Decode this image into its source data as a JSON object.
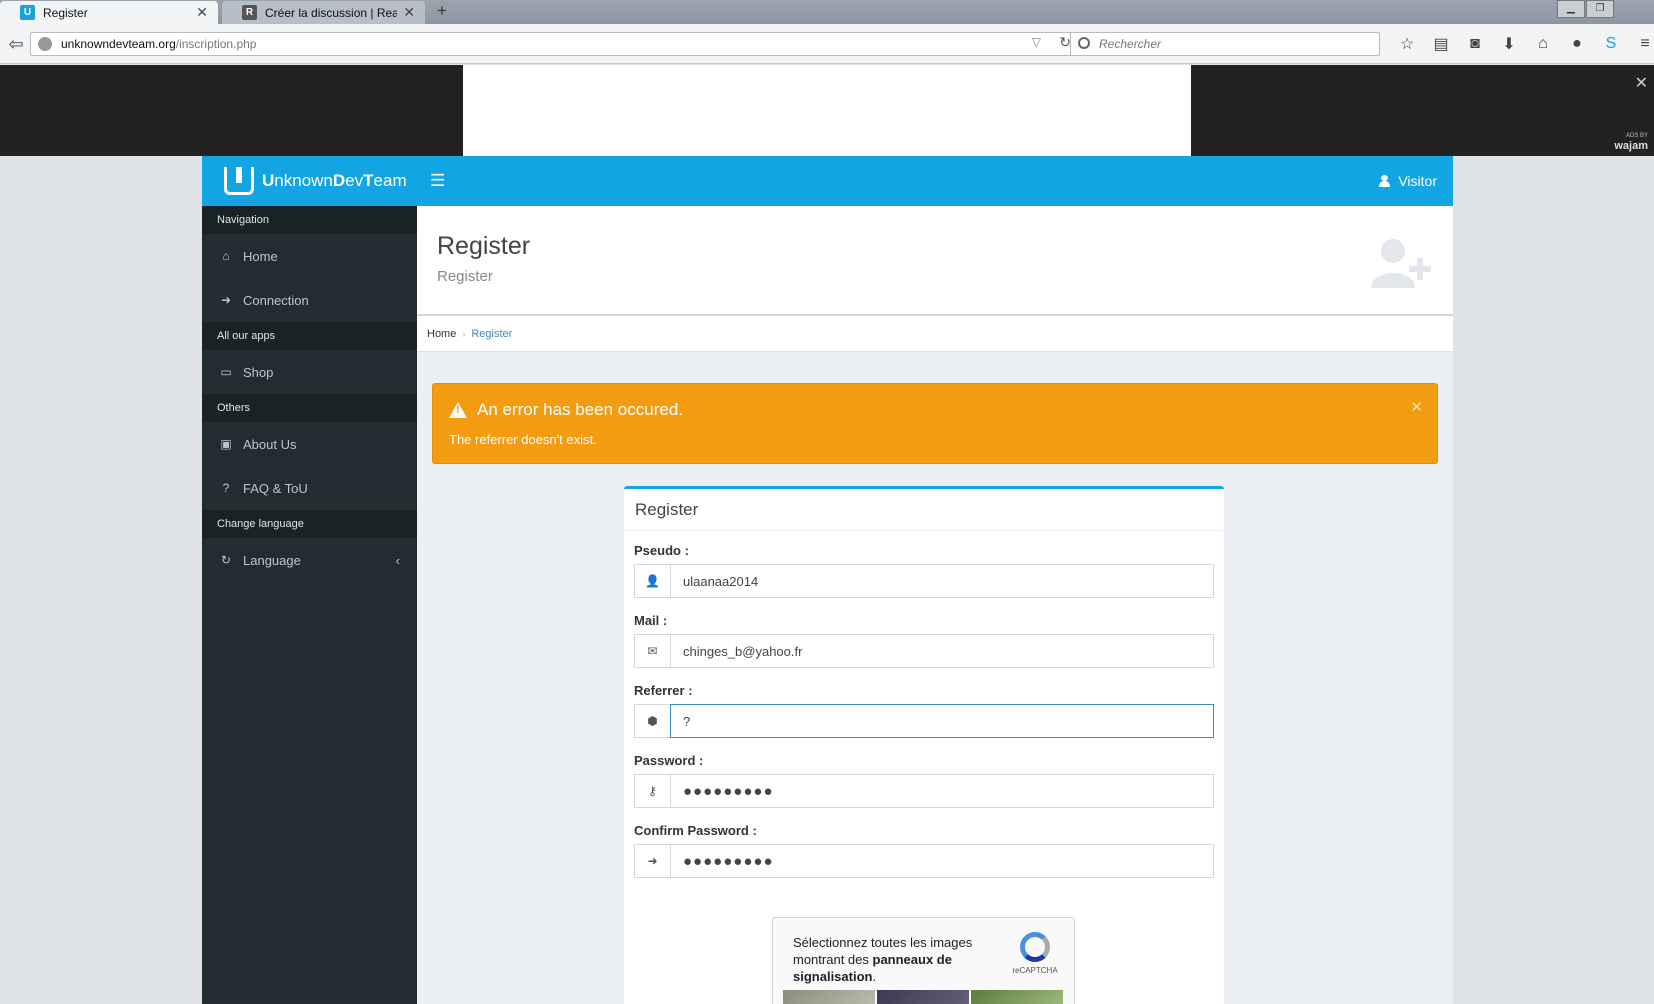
{
  "browser": {
    "tabs": [
      {
        "label": "Register",
        "active": true
      },
      {
        "label": "Créer la discussion | Reality...",
        "active": false
      }
    ],
    "url_domain": "unknowndevteam.org",
    "url_path": "/inscription.php",
    "search_placeholder": "Rechercher"
  },
  "ad": {
    "ads_by": "ADS BY",
    "ads_brand": "wajam"
  },
  "site": {
    "brand_first": "U",
    "brand_rest": "nknownDevTeam",
    "brand_parts": [
      "U",
      "nknown",
      "D",
      "ev",
      "T",
      "eam"
    ],
    "user_label": "Visitor",
    "accent_color": "#13a5e3",
    "sidebar": {
      "sections": [
        {
          "header": "Navigation",
          "items": [
            {
              "label": "Home",
              "icon": "home-icon"
            },
            {
              "label": "Connection",
              "icon": "sign-in-icon"
            }
          ]
        },
        {
          "header": "All our apps",
          "items": [
            {
              "label": "Shop",
              "icon": "desktop-icon"
            }
          ]
        },
        {
          "header": "Others",
          "items": [
            {
              "label": "About Us",
              "icon": "lock-icon"
            },
            {
              "label": "FAQ & ToU",
              "icon": "question-icon"
            }
          ]
        },
        {
          "header": "Change language",
          "items": [
            {
              "label": "Language",
              "icon": "refresh-icon"
            }
          ]
        }
      ]
    },
    "page": {
      "title": "Register",
      "subtitle": "Register",
      "breadcrumb": [
        "Home",
        "Register"
      ]
    },
    "alert": {
      "title": "An error has been occured.",
      "message": "The referrer doesn't exist.",
      "color": "#f39c12"
    },
    "form": {
      "title": "Register",
      "fields": [
        {
          "label": "Pseudo :",
          "value": "ulaanaa2014",
          "icon": "user-icon"
        },
        {
          "label": "Mail :",
          "value": "chinges_b@yahoo.fr",
          "icon": "envelope-icon"
        },
        {
          "label": "Referrer :",
          "value": "?",
          "icon": "tag-icon"
        },
        {
          "label": "Password :",
          "value": "●●●●●●●●●",
          "icon": "key-icon"
        },
        {
          "label": "Confirm Password :",
          "value": "●●●●●●●●●",
          "icon": "sign-in-icon"
        }
      ],
      "captcha": {
        "prompt_start": "Sélectionnez toutes les images montrant des ",
        "prompt_bold": "panneaux de signalisation",
        "prompt_end": ".",
        "brand": "reCAPTCHA"
      }
    }
  }
}
